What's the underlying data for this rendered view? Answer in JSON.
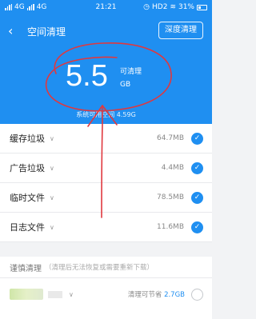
{
  "status_bar": {
    "left_label_1": "4G",
    "left_label_2": "4G",
    "time": "21:21",
    "hd_label": "HD2",
    "battery": "31%"
  },
  "header": {
    "back_icon": "chevron-left-icon",
    "title": "空间清理",
    "deep_clean_label": "深度清理"
  },
  "summary": {
    "size_value": "5.5",
    "size_label": "可清理",
    "size_unit": "GB",
    "available_text": "系统可用空间 4.59G"
  },
  "items": [
    {
      "label": "缓存垃圾",
      "size": "64.7MB",
      "checked": true
    },
    {
      "label": "广告垃圾",
      "size": "4.4MB",
      "checked": true
    },
    {
      "label": "临时文件",
      "size": "78.5MB",
      "checked": true
    },
    {
      "label": "日志文件",
      "size": "11.6MB",
      "checked": true
    }
  ],
  "caution": {
    "title": "谨慎清理",
    "note": "（清理后无法恢复或需要重新下载）"
  },
  "caution_item": {
    "savable_label": "清理可节省",
    "savable_value": "2.7GB",
    "checked": false
  },
  "colors": {
    "accent": "#1f8ff1",
    "annotation": "#e0383e"
  }
}
